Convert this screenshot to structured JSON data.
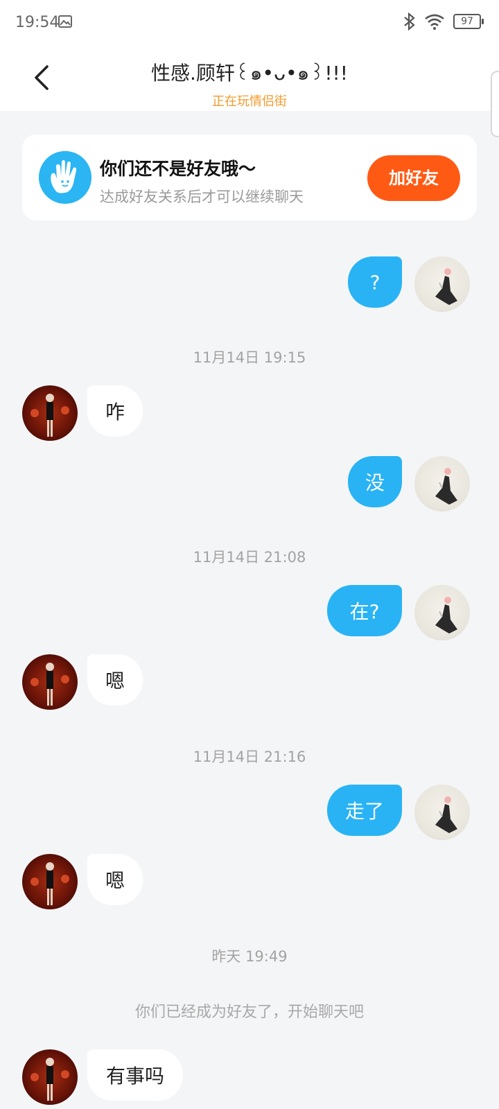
{
  "status_bar": {
    "time": "19:54",
    "battery": "97"
  },
  "header": {
    "title": "性感.顾轩꒰๑•ᴗ•๑꒱!!!",
    "subtitle": "正在玩情侣街"
  },
  "friend_banner": {
    "title": "你们还不是好友哦～",
    "description": "达成好友关系后才可以继续聊天",
    "button_label": "加好友"
  },
  "messages": [
    {
      "from": "self",
      "text": "?"
    },
    {
      "timestamp": "11月14日 19:15"
    },
    {
      "from": "peer",
      "text": "咋"
    },
    {
      "from": "self",
      "text": "没"
    },
    {
      "timestamp": "11月14日 21:08"
    },
    {
      "from": "self",
      "text": "在?"
    },
    {
      "from": "peer",
      "text": "嗯"
    },
    {
      "timestamp": "11月14日 21:16"
    },
    {
      "from": "self",
      "text": "走了"
    },
    {
      "from": "peer",
      "text": "嗯"
    },
    {
      "timestamp": "昨天 19:49"
    },
    {
      "system": "你们已经成为好友了，开始聊天吧"
    },
    {
      "from": "peer",
      "text": "有事吗"
    }
  ],
  "colors": {
    "accent_blue": "#29b3f5",
    "add_button": "#ff5a14",
    "subtitle_orange": "#f39a2b"
  }
}
